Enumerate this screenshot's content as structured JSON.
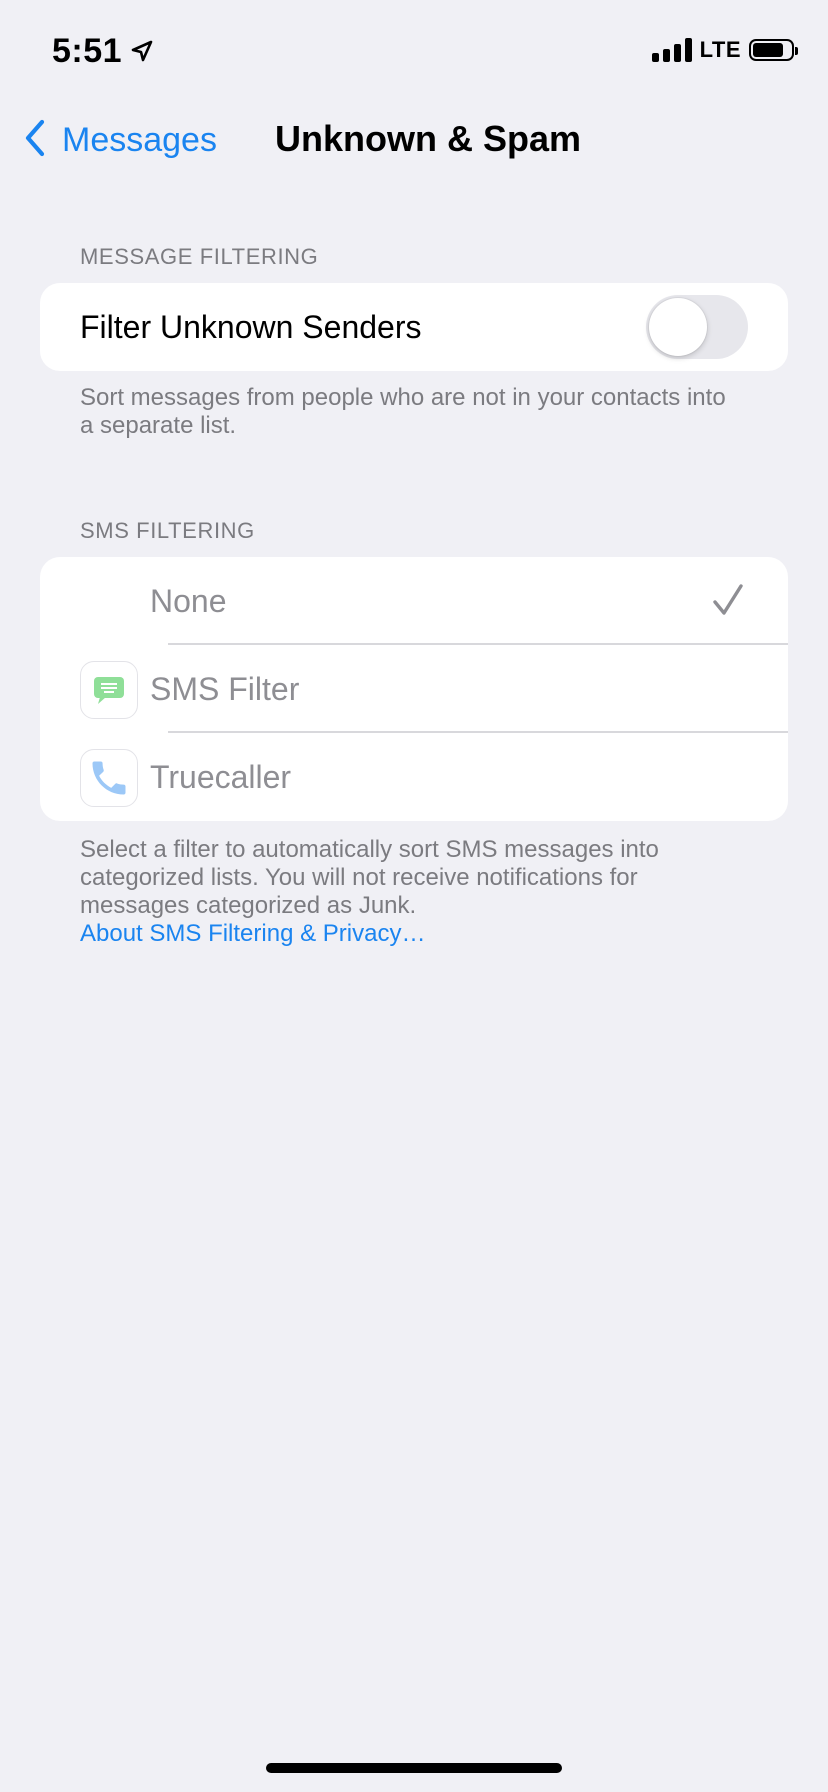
{
  "status_bar": {
    "time": "5:51",
    "network": "LTE",
    "battery_level_percent": 80,
    "icons": [
      "location-arrow-icon",
      "cellular-signal-icon",
      "battery-icon"
    ]
  },
  "nav": {
    "back_label": "Messages",
    "title": "Unknown & Spam"
  },
  "message_filtering": {
    "header": "MESSAGE FILTERING",
    "toggle_label": "Filter Unknown Senders",
    "toggle_on": false,
    "footer": "Sort messages from people who are not in your contacts into a separate list."
  },
  "sms_filtering": {
    "header": "SMS FILTERING",
    "options": [
      {
        "label": "None",
        "selected": true,
        "icon": "none"
      },
      {
        "label": "SMS Filter",
        "selected": false,
        "icon": "sms-filter-app-icon"
      },
      {
        "label": "Truecaller",
        "selected": false,
        "icon": "truecaller-app-icon"
      }
    ],
    "footer": "Select a filter to automatically sort SMS messages into categorized lists. You will not receive notifications for messages categorized as Junk.",
    "link": "About SMS Filtering & Privacy…"
  },
  "colors": {
    "background": "#f0f0f5",
    "accent": "#1a84f0",
    "secondary_text": "#7b7b80",
    "sms_filter_icon": "#8fdf98",
    "truecaller_icon": "#9cc8f7"
  }
}
